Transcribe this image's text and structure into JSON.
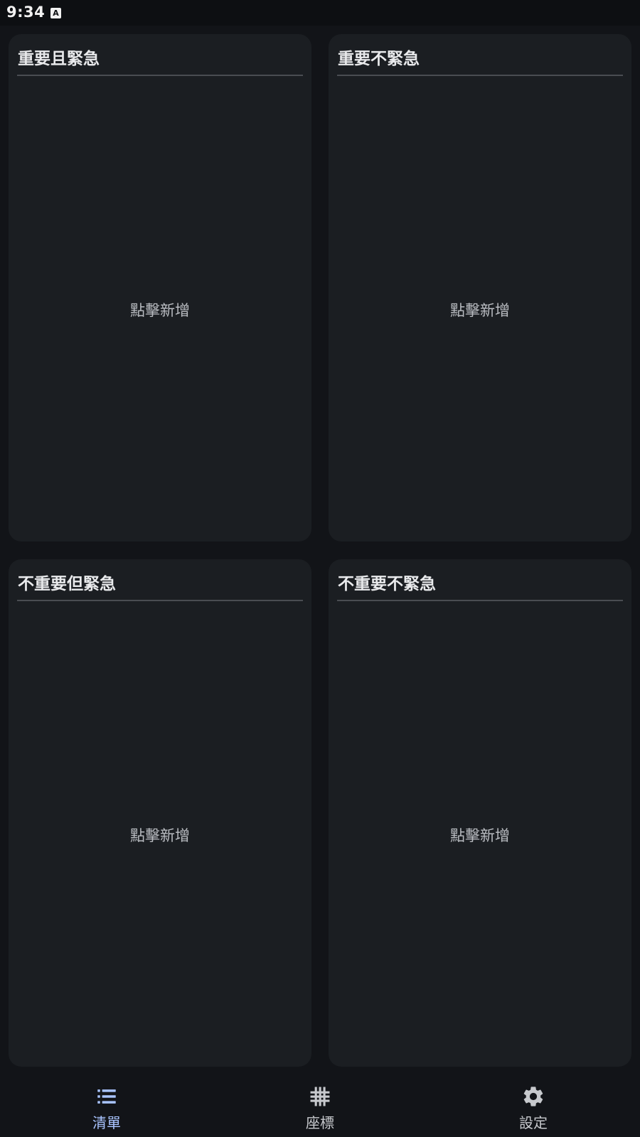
{
  "status_bar": {
    "time": "9:34",
    "app_icon": "A"
  },
  "quadrants": [
    {
      "title": "重要且緊急",
      "empty_hint": "點擊新增"
    },
    {
      "title": "重要不緊急",
      "empty_hint": "點擊新增"
    },
    {
      "title": "不重要但緊急",
      "empty_hint": "點擊新增"
    },
    {
      "title": "不重要不緊急",
      "empty_hint": "點擊新增"
    }
  ],
  "bottom_nav": {
    "items": [
      {
        "label": "清單",
        "icon": "list-icon",
        "active": true
      },
      {
        "label": "座標",
        "icon": "grid-icon",
        "active": false
      },
      {
        "label": "設定",
        "icon": "gear-icon",
        "active": false
      }
    ]
  },
  "colors": {
    "background": "#121418",
    "card": "#1b1e22",
    "accent": "#a9c4ff",
    "icon": "#c7c9cd"
  }
}
